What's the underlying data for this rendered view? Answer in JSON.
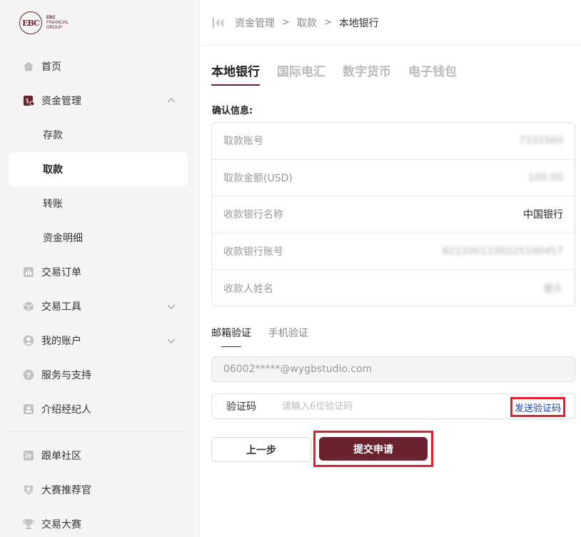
{
  "logo": {
    "mark": "EBC",
    "line1": "EBC",
    "line2": "FINANCIAL",
    "line3": "GROUP"
  },
  "sidebar": {
    "items": [
      {
        "label": "首页",
        "icon": "home-icon"
      },
      {
        "label": "资金管理",
        "icon": "wallet-icon"
      },
      {
        "label": "存款"
      },
      {
        "label": "取款"
      },
      {
        "label": "转账"
      },
      {
        "label": "资金明细"
      },
      {
        "label": "交易订单",
        "icon": "chart-icon"
      },
      {
        "label": "交易工具",
        "icon": "cube-icon"
      },
      {
        "label": "我的账户",
        "icon": "user-icon"
      },
      {
        "label": "服务与支持",
        "icon": "help-icon"
      },
      {
        "label": "介绍经纪人",
        "icon": "id-card-icon"
      },
      {
        "label": "跟单社区",
        "icon": "forward-icon"
      },
      {
        "label": "大赛推荐官",
        "icon": "badge-icon"
      },
      {
        "label": "交易大赛",
        "icon": "trophy-icon"
      }
    ]
  },
  "breadcrumb": {
    "items": [
      "资金管理",
      "取款",
      "本地银行"
    ],
    "separator": ">"
  },
  "tabs": [
    "本地银行",
    "国际电汇",
    "数字货币",
    "电子钱包"
  ],
  "confirm": {
    "title": "确认信息:",
    "rows": [
      {
        "label": "取款账号",
        "value": "7331560"
      },
      {
        "label": "取款金额(USD)",
        "value": "100.00"
      },
      {
        "label": "收款银行名称",
        "value": "中国银行"
      },
      {
        "label": "收款银行账号",
        "value": "6222001100225100457"
      },
      {
        "label": "收款人姓名",
        "value": "曾久"
      }
    ]
  },
  "verify": {
    "tabs": [
      "邮箱验证",
      "手机验证"
    ],
    "email": "06002*****@wygbstudio.com",
    "code_label": "验证码",
    "code_placeholder": "请输入6位验证码",
    "send_code": "发送验证码"
  },
  "buttons": {
    "prev": "上一步",
    "submit": "提交申请"
  },
  "colors": {
    "brand": "#6b2230",
    "highlight": "#e0202b",
    "link": "#1a3fa0"
  }
}
